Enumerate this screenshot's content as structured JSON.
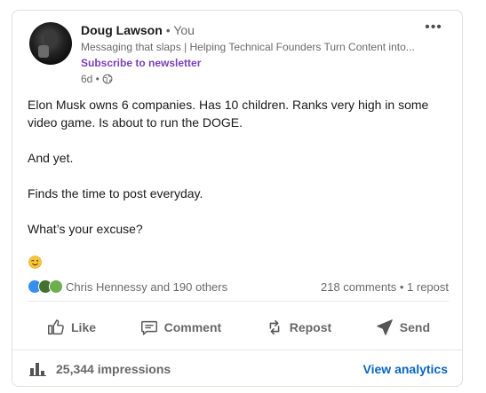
{
  "author": {
    "name": "Doug Lawson",
    "you_label": "• You",
    "headline": "Messaging that slaps | Helping Technical Founders Turn Content into...",
    "subscribe_label": "Subscribe to newsletter",
    "posted_ago": "6d •",
    "visibility_icon": "globe-icon"
  },
  "more_menu": {
    "label": "•••"
  },
  "post": {
    "paragraphs": [
      "Elon Musk owns 6 companies. Has 10 children. Ranks very high in some video game. Is about to run the DOGE.",
      "And yet.",
      "Finds the time to post everyday.",
      "What’s your excuse?"
    ],
    "emoji": "winking-face-emoji"
  },
  "social": {
    "reaction_icons": [
      "like-reaction-icon",
      "celebrate-reaction-icon",
      "support-reaction-icon"
    ],
    "reactors_text": "Chris Hennessy and 190 others",
    "comments_reposts_text": "218 comments • 1 repost"
  },
  "actions": [
    {
      "name": "like",
      "label": "Like",
      "icon": "thumbs-up-icon"
    },
    {
      "name": "comment",
      "label": "Comment",
      "icon": "comment-bubble-icon"
    },
    {
      "name": "repost",
      "label": "Repost",
      "icon": "repost-arrows-icon"
    },
    {
      "name": "send",
      "label": "Send",
      "icon": "paper-plane-icon"
    }
  ],
  "footer": {
    "impressions_text": "25,344 impressions",
    "analytics_label": "View analytics"
  },
  "colors": {
    "accent_blue": "#0a66c2",
    "subscribe_purple": "#7a3fb8",
    "text_secondary": "#666666"
  }
}
